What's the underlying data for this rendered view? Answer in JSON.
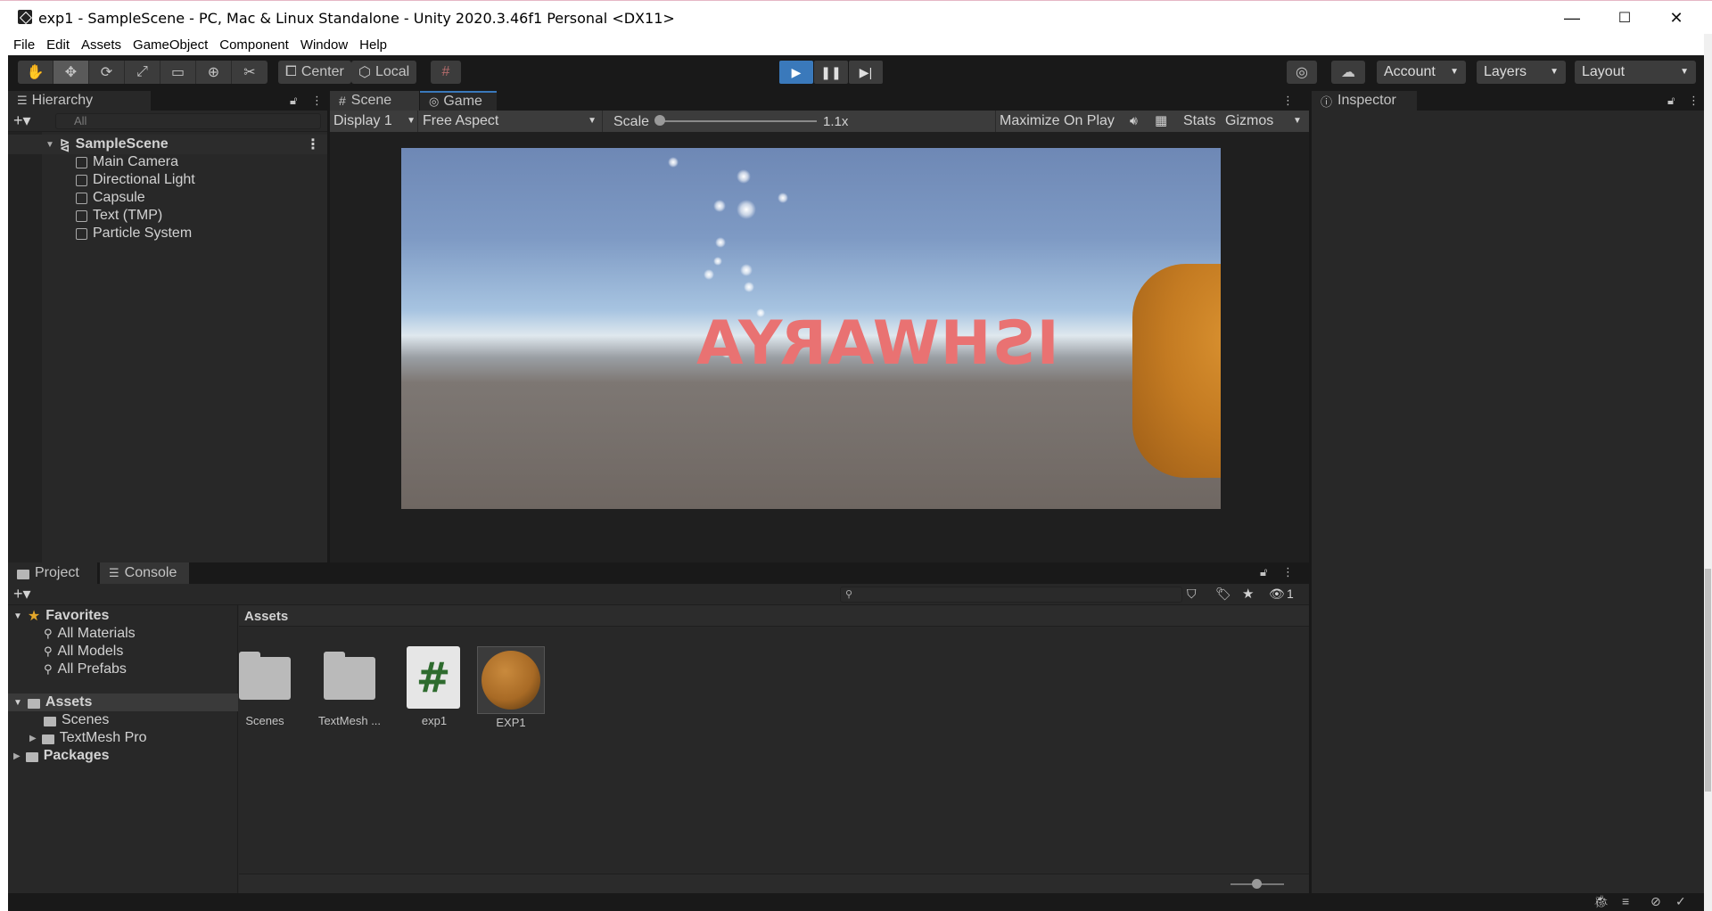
{
  "window": {
    "title": "exp1 - SampleScene - PC, Mac & Linux Standalone - Unity 2020.3.46f1 Personal <DX11>",
    "minimize": "—",
    "maximize": "☐",
    "close": "✕"
  },
  "menu": [
    "File",
    "Edit",
    "Assets",
    "GameObject",
    "Component",
    "Window",
    "Help"
  ],
  "toolbar": {
    "pivot_label": "Center",
    "space_label": "Local",
    "account": "Account",
    "layers": "Layers",
    "layout": "Layout"
  },
  "hierarchy": {
    "tab": "Hierarchy",
    "search_placeholder": "All",
    "scene": "SampleScene",
    "objects": [
      "Main Camera",
      "Directional Light",
      "Capsule",
      "Text (TMP)",
      "Particle System"
    ]
  },
  "game": {
    "tabs": [
      "Scene",
      "Game"
    ],
    "display": "Display 1",
    "aspect": "Free Aspect",
    "scale_label": "Scale",
    "scale_value": "1.1x",
    "maximize": "Maximize On Play",
    "stats": "Stats",
    "gizmos": "Gizmos",
    "scene_text": "ISHWARYA"
  },
  "inspector": {
    "tab": "Inspector"
  },
  "project": {
    "tabs": [
      "Project",
      "Console"
    ],
    "favorites": "Favorites",
    "favorite_items": [
      "All Materials",
      "All Models",
      "All Prefabs"
    ],
    "assets_root": "Assets",
    "asset_children": [
      "Scenes",
      "TextMesh Pro"
    ],
    "packages": "Packages",
    "breadcrumb": "Assets",
    "hidden_count": "1",
    "assets": [
      {
        "name": "Scenes",
        "kind": "folder"
      },
      {
        "name": "TextMesh ...",
        "kind": "folder"
      },
      {
        "name": "exp1",
        "kind": "script"
      },
      {
        "name": "EXP1",
        "kind": "material"
      }
    ]
  }
}
